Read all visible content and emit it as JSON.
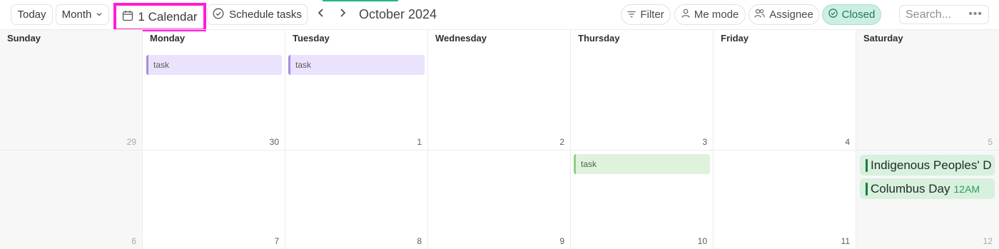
{
  "toolbar": {
    "today_label": "Today",
    "view_label": "Month",
    "calendar_label": "1 Calendar",
    "schedule_label": "Schedule tasks",
    "month_title": "October 2024",
    "filter_label": "Filter",
    "me_mode_label": "Me mode",
    "assignee_label": "Assignee",
    "closed_label": "Closed",
    "search_placeholder": "Search...",
    "more_label": "•••"
  },
  "colors": {
    "highlight_border": "#ff1cd6",
    "closed_pill_bg": "#cdeee2",
    "task_purple": "#ebe2fd",
    "task_green": "#dff3dc",
    "holiday_bar": "#1f7a44"
  },
  "weekdays": [
    "Sunday",
    "Monday",
    "Tuesday",
    "Wednesday",
    "Thursday",
    "Friday",
    "Saturday"
  ],
  "weeks": [
    {
      "days": [
        "29",
        "30",
        "1",
        "2",
        "3",
        "4",
        "5"
      ]
    },
    {
      "days": [
        "6",
        "7",
        "8",
        "9",
        "10",
        "11",
        "12"
      ]
    }
  ],
  "events": {
    "mon_task": "task",
    "tue_task": "task",
    "thu_task": "task",
    "holiday_1": "Indigenous Peoples' D",
    "holiday_2": "Columbus Day",
    "holiday_2_time": "12AM"
  }
}
